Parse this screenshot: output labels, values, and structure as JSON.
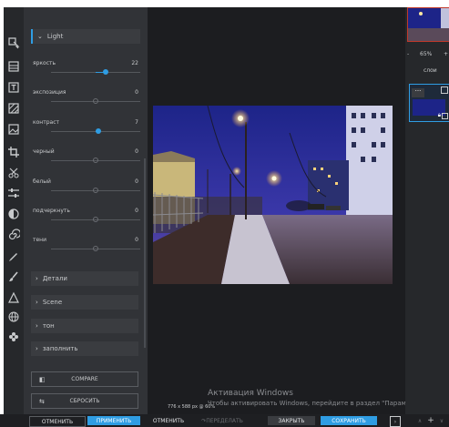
{
  "colors": {
    "accent": "#2f9de3",
    "panel": "#313337",
    "background": "#1c1d20"
  },
  "toolbar": {
    "icons": [
      "select-icon",
      "layers-icon",
      "text-icon",
      "texture-icon",
      "image-icon",
      "crop-icon",
      "cut-icon",
      "adjust-icon",
      "contrast-icon",
      "spiral-icon",
      "pencil-icon",
      "brush-icon",
      "shape-icon",
      "globe-icon",
      "flower-icon",
      "settings-icon"
    ]
  },
  "light_section": {
    "title": "Light",
    "sliders": [
      {
        "label": "яркость",
        "value": "22",
        "level": 0.22
      },
      {
        "label": "экспозиция",
        "value": "0",
        "level": 0
      },
      {
        "label": "контраст",
        "value": "7",
        "level": 0.07
      },
      {
        "label": "черный",
        "value": "0",
        "level": 0
      },
      {
        "label": "белый",
        "value": "0",
        "level": 0
      },
      {
        "label": "подчеркнуть",
        "value": "0",
        "level": 0
      },
      {
        "label": "тени",
        "value": "0",
        "level": 0
      }
    ]
  },
  "collapsed_sections": [
    "Детали",
    "Scene",
    "тон",
    "заполнить"
  ],
  "compare_label": "COMPARE",
  "reset_label": "СБРОСИТЬ",
  "image_dims": "776 x 588 px @ 60%",
  "zoom": "65%",
  "layers_label": "слои",
  "watermark": {
    "title": "Активация Windows",
    "subtitle": "Чтобы активировать Windows, перейдите в раздел \"Параметры\"."
  },
  "bottom": {
    "cancel": "ОТМЕНИТЬ",
    "apply": "ПРИМЕНИТЬ",
    "undo": "ОТМЕНИТЬ",
    "redo": "ПЕРЕДЕЛАТЬ",
    "close": "ЗАКРЫТЬ",
    "save": "СОХРАНИТЬ"
  }
}
